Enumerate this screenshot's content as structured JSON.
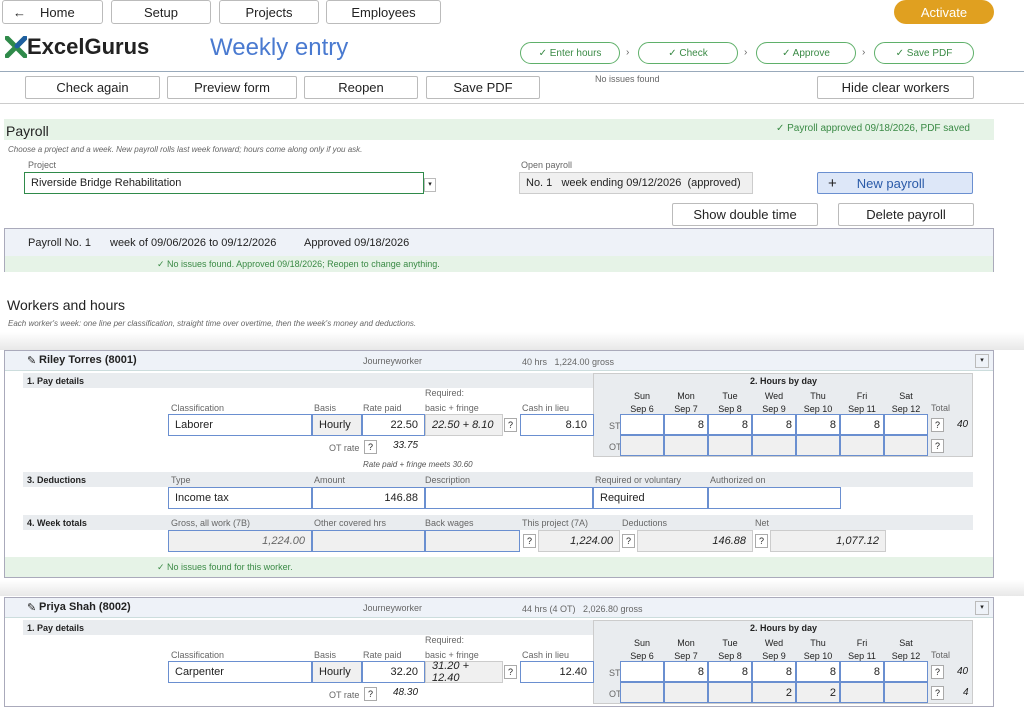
{
  "nav": {
    "home": "Home",
    "setup": "Setup",
    "projects": "Projects",
    "employees": "Employees",
    "activate": "Activate",
    "back_icon": "arrow-left-icon"
  },
  "brand": "ExcelGurus",
  "page_title": "Weekly entry",
  "steps": [
    "✓ Enter hours",
    "✓ Check",
    "✓ Approve",
    "✓ Save PDF"
  ],
  "toolbar": {
    "check_again": "Check again",
    "preview_form": "Preview form",
    "reopen": "Reopen",
    "save_pdf": "Save PDF",
    "hide_clear": "Hide clear workers",
    "status": "No issues found"
  },
  "payroll": {
    "heading": "Payroll",
    "approved_status": "✓ Payroll approved 09/18/2026, PDF saved",
    "hint": "Choose a project and a week. New payroll rolls last week forward; hours come along only if you ask.",
    "project_label": "Project",
    "project_value": "Riverside Bridge Rehabilitation",
    "open_label": "Open payroll",
    "open_value": "No. 1   week ending 09/12/2026  (approved)",
    "new_payroll": "New payroll",
    "plus": "+",
    "show_double": "Show double time",
    "delete": "Delete payroll"
  },
  "summary": {
    "no": "Payroll No. 1",
    "week": "week of 09/06/2026 to 09/12/2026",
    "approved": "Approved 09/18/2026",
    "status": "✓  No issues found. Approved 09/18/2026; Reopen to change anything."
  },
  "workers_heading": "Workers and hours",
  "workers_hint": "Each worker's week: one line per classification, straight time over overtime, then the week's money and deductions.",
  "labels": {
    "pay_details": "1. Pay details",
    "hours_by_day": "2. Hours by day",
    "deductions": "3. Deductions",
    "week_totals": "4. Week totals",
    "classification": "Classification",
    "basis": "Basis",
    "rate_paid": "Rate paid",
    "required": "Required:",
    "basic_fringe": "basic + fringe",
    "cash": "Cash in lieu",
    "ot_rate": "OT rate",
    "st": "ST",
    "ot": "OT",
    "total": "Total",
    "type": "Type",
    "amount": "Amount",
    "description": "Description",
    "req_vol": "Required or voluntary",
    "authorized": "Authorized on",
    "gross": "Gross, all work (7B)",
    "other_hrs": "Other covered hrs",
    "back_wages": "Back wages",
    "this_project": "This project (7A)",
    "ded": "Deductions",
    "net": "Net",
    "q": "?",
    "dd": "▾"
  },
  "days": [
    {
      "d": "Sun",
      "dt": "Sep 6"
    },
    {
      "d": "Mon",
      "dt": "Sep 7"
    },
    {
      "d": "Tue",
      "dt": "Sep 8"
    },
    {
      "d": "Wed",
      "dt": "Sep 9"
    },
    {
      "d": "Thu",
      "dt": "Sep 10"
    },
    {
      "d": "Fri",
      "dt": "Sep 11"
    },
    {
      "d": "Sat",
      "dt": "Sep 12"
    }
  ],
  "workers": [
    {
      "name": "Riley Torres (8001)",
      "role": "Journeyworker",
      "hours": "40 hrs   1,224.00 gross",
      "classification": "Laborer",
      "basis": "Hourly",
      "rate": "22.50",
      "required": "22.50 + 8.10",
      "cash": "8.10",
      "ot_rate": "33.75",
      "rate_note": "Rate paid + fringe meets 30.60",
      "st": [
        "",
        "8",
        "8",
        "8",
        "8",
        "8",
        ""
      ],
      "st_total": "40",
      "ot": [
        "",
        "",
        "",
        "",
        "",
        "",
        ""
      ],
      "ot_total": "",
      "ded_type": "Income tax",
      "ded_amount": "146.88",
      "ded_desc": "",
      "ded_req": "Required",
      "ded_auth": "",
      "gross": "1,224.00",
      "other_hrs": "",
      "back_wages": "",
      "this_project": "1,224.00",
      "deductions": "146.88",
      "net": "1,077.12",
      "status": "✓  No issues found for this worker."
    },
    {
      "name": "Priya Shah (8002)",
      "role": "Journeyworker",
      "hours": "44 hrs (4 OT)   2,026.80 gross",
      "classification": "Carpenter",
      "basis": "Hourly",
      "rate": "32.20",
      "required": "31.20 + 12.40",
      "cash": "12.40",
      "ot_rate": "48.30",
      "st": [
        "",
        "8",
        "8",
        "8",
        "8",
        "8",
        ""
      ],
      "st_total": "40",
      "ot": [
        "",
        "",
        "",
        "2",
        "2",
        "",
        ""
      ],
      "ot_total": "4"
    }
  ]
}
